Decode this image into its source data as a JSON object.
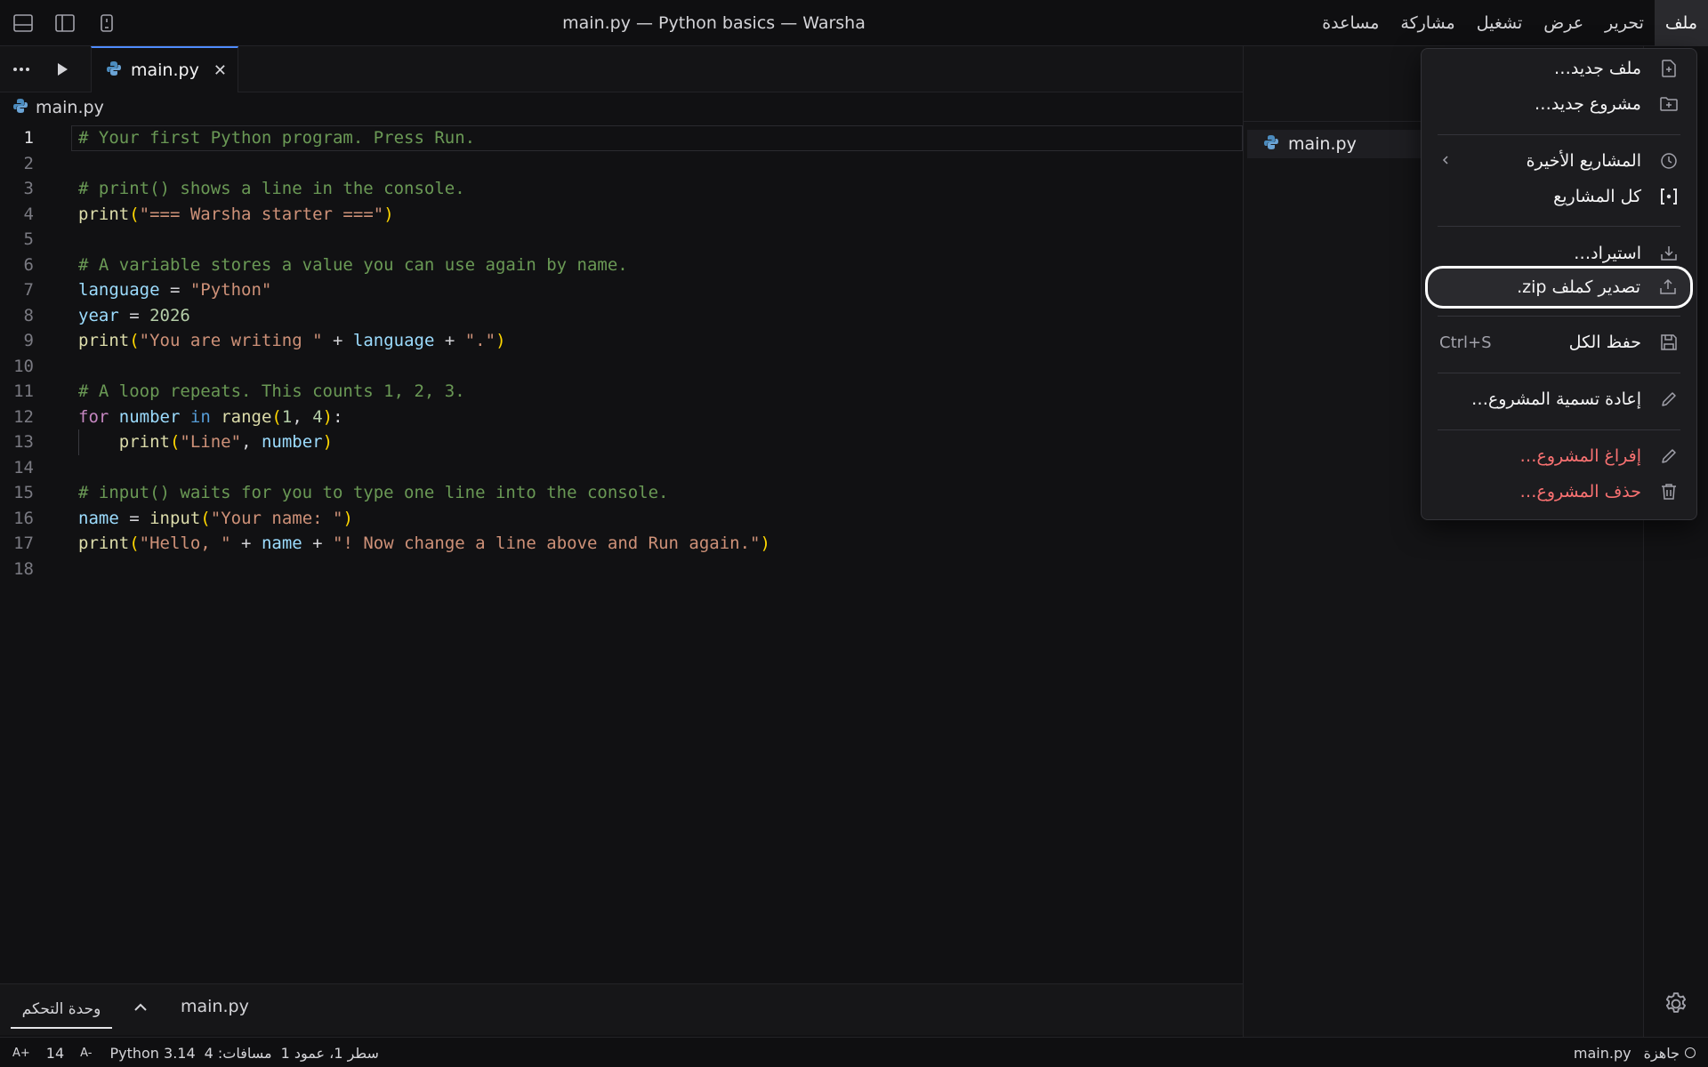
{
  "window": {
    "title": "main.py — Python basics — Warsha"
  },
  "menubar": [
    "ملف",
    "تحرير",
    "عرض",
    "تشغيل",
    "مشاركة",
    "مساعدة"
  ],
  "tab": {
    "label": "main.py",
    "close": "✕"
  },
  "breadcrumb": "main.py",
  "editor": {
    "current_line": 1,
    "lines": [
      "# Your first Python program. Press Run.",
      "",
      "# print() shows a line in the console.",
      "print(\"=== Warsha starter ===\")",
      "",
      "# A variable stores a value you can use again by name.",
      "language = \"Python\"",
      "year = 2026",
      "print(\"You are writing \" + language + \".\")",
      "",
      "# A loop repeats. This counts 1, 2, 3.",
      "for number in range(1, 4):",
      "    print(\"Line\", number)",
      "",
      "# input() waits for you to type one line into the console.",
      "name = input(\"Your name: \")",
      "print(\"Hello, \" + name + \"! Now change a line above and Run again.\")",
      ""
    ]
  },
  "sidepanel": {
    "file": "main.py"
  },
  "console": {
    "tab_label": "وحدة التحكم",
    "file": "main.py"
  },
  "statusbar": {
    "font_increase": "A+",
    "font_size": "14",
    "font_decrease": "A-",
    "language": "Python 3.14",
    "indent": "مسافات: 4",
    "position": "سطر 1، عمود 1",
    "status": "جاهزة",
    "file": "main.py"
  },
  "file_menu": {
    "new_file": "ملف جديد…",
    "new_project": "مشروع جديد…",
    "recent_projects": "المشاريع الأخيرة",
    "all_projects": "كل المشاريع",
    "import": "استيراد…",
    "export_zip": "تصدير كملف zip.",
    "save_all": "حفظ الكل",
    "save_all_shortcut": "Ctrl+S",
    "rename_project": "إعادة تسمية المشروع…",
    "clear_project": "إفراغ المشروع…",
    "delete_project": "حذف المشروع…"
  },
  "colors": {
    "accent": "#4f8cff",
    "danger": "#f87171",
    "comment": "#6a9955",
    "string": "#ce9178"
  }
}
